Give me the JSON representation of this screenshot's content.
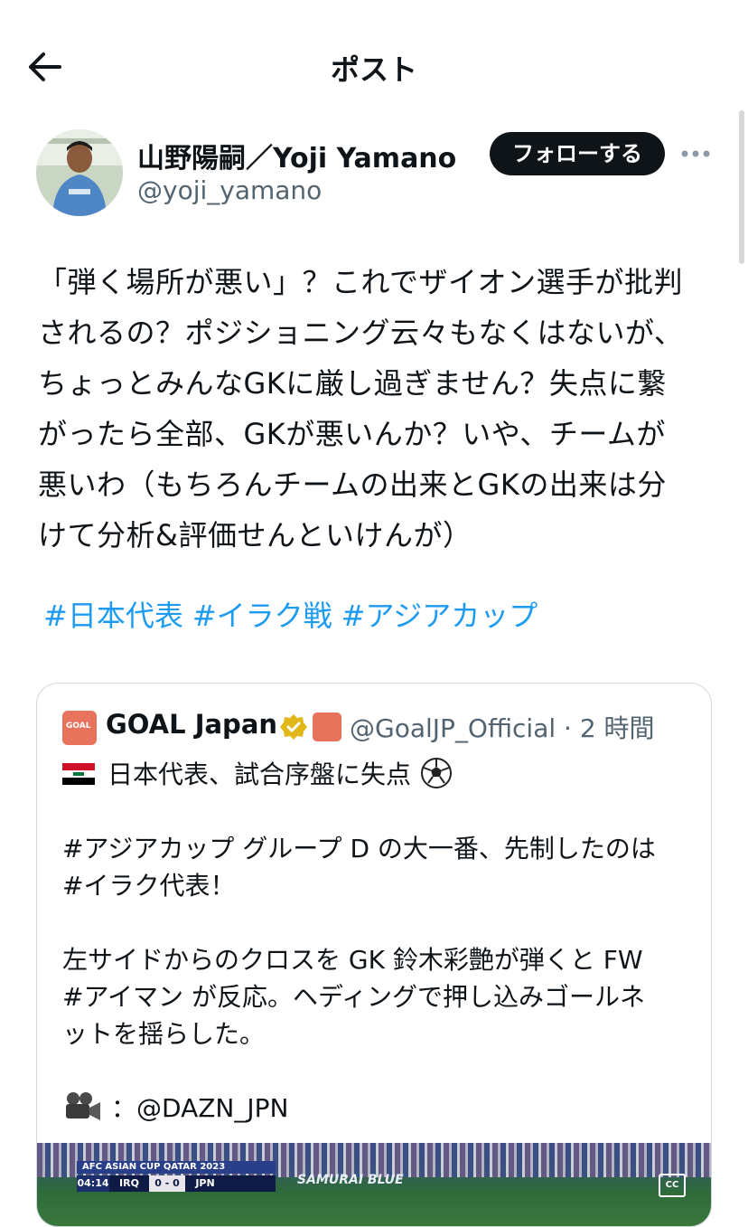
{
  "header": {
    "title": "ポスト",
    "back_icon": "arrow-left-icon"
  },
  "author": {
    "display_name": "山野陽嗣／Yoji Yamano",
    "handle": "@yoji_yamano",
    "follow_label": "フォローする",
    "more_icon": "more-horizontal-icon"
  },
  "post": {
    "lines": [
      "「弾く場所が悪い」？これでザイオン選手が批判",
      "されるの？ポジショニング云々もなくはないが、",
      "ちょっとみんなGKに厳し過ぎません？失点に繋",
      "がったら全部、GKが悪いんか？いや、チームが",
      "悪いわ（もちろんチームの出来とGKの出来は分",
      "けて分析&評価せんといけんが）"
    ],
    "hashtags": [
      "#日本代表",
      "#イラク戦",
      "#アジアカップ"
    ]
  },
  "quote": {
    "name": "GOAL Japan",
    "logo_text": "GOAL",
    "handle_time": "@GoalJP_Official · 2 時間",
    "headline": "日本代表、試合序盤に失点",
    "para1": [
      "#アジアカップ グループ D の大一番、先制したのは",
      "#イラク代表！"
    ],
    "para2": [
      "左サイドからのクロスを GK 鈴木彩艶が弾くと FW",
      "#アイマン が反応。ヘディングで押し込みゴールネ",
      "ットを揺らした。"
    ],
    "credit": "：@DAZN_JPN",
    "video": {
      "banner": "AFC ASIAN CUP QATAR 2023",
      "time": "04:14",
      "team_home": "IRQ",
      "score": "0 - 0",
      "team_away": "JPN",
      "ad_text": "SAMURAI BLUE",
      "cc_label": "CC"
    }
  },
  "colors": {
    "link": "#1d9bf0",
    "follow_bg": "#0f1419",
    "secondary_text": "#536471",
    "goal_brand": "#e8735d",
    "verified_gold": "#e2b719"
  }
}
